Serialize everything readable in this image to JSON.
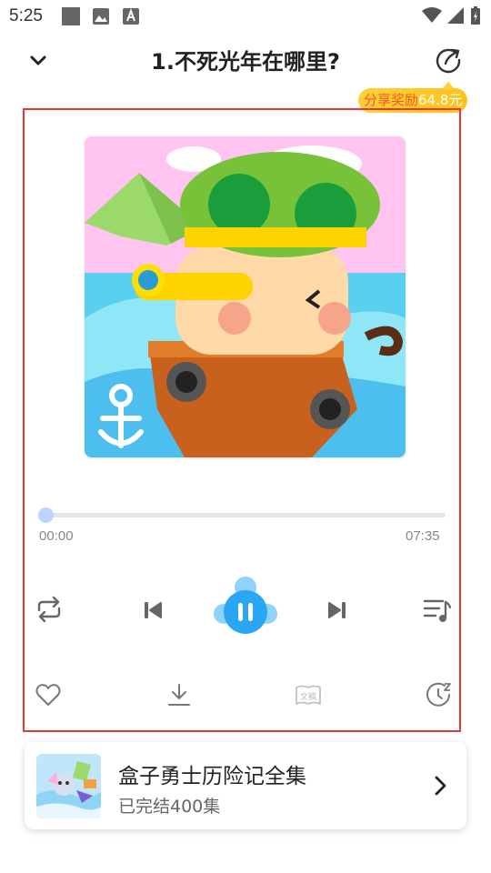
{
  "status_bar": {
    "time": "5:25",
    "icons": [
      "image-placeholder-icon",
      "gallery-icon",
      "font-app-icon",
      "wifi-icon",
      "cell-signal-icon",
      "battery-charging-icon"
    ]
  },
  "header": {
    "title": "1.不死光年在哪里?",
    "back_icon": "chevron-down-icon",
    "share_icon": "share-arrow-icon",
    "share_reward_label": "分享奖励",
    "share_reward_amount": "64.8元"
  },
  "player": {
    "current_time": "00:00",
    "total_time": "07:35",
    "progress": 0,
    "state": "playing",
    "controls": [
      "repeat-icon",
      "previous-icon",
      "pause-icon",
      "next-icon",
      "playlist-icon"
    ],
    "actions": [
      "like-icon",
      "download-icon",
      "transcript-icon",
      "sleep-timer-icon"
    ],
    "transcript_label": "文稿"
  },
  "album": {
    "name": "盒子勇士历险记全集",
    "subtitle": "已完结400集"
  },
  "colors": {
    "accent": "#2aa6f5",
    "highlight_border": "#e53935",
    "reward_bg": "#ffc21b",
    "reward_text": "#f05a22"
  }
}
